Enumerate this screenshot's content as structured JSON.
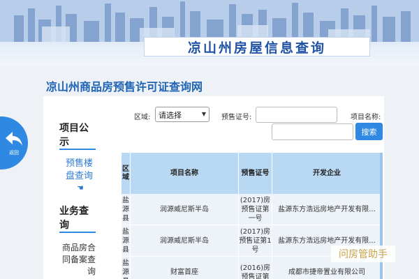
{
  "banner": {
    "title": "凉山州房屋信息查询"
  },
  "site": {
    "title": "凉山州商品房预售许可证查询网"
  },
  "back": {
    "label": "返回",
    "icon": "back-arrow-icon"
  },
  "nav": {
    "section1_title": "项目公示",
    "presale_item": "预售楼盘查询",
    "presale_icon": "☚",
    "section2_title": "业务查询",
    "contract_item": "商品房合同备案查询"
  },
  "search": {
    "region_label": "区域:",
    "region_value": "请选择",
    "license_label": "预售证号:",
    "license_value": "",
    "project_label": "项目名称:",
    "project_value": "",
    "button": "搜索"
  },
  "table": {
    "columns": [
      "区域",
      "项目名称",
      "预售证号",
      "开发企业"
    ],
    "rows": [
      {
        "region": "盐源县",
        "project": "润源威尼斯半岛",
        "license": "(2017)房预售证第一号",
        "developer": "盐源东方浩远房地产开发有限..."
      },
      {
        "region": "盐源县",
        "project": "润源威尼斯半岛",
        "license": "(2017)房预售证第1号",
        "developer": "盐源东方浩远房地产开发有限..."
      },
      {
        "region": "盐源县",
        "project": "财富首座",
        "license": "(2016)房预售证第",
        "developer": "成都市捷帝置业有限公司"
      }
    ]
  },
  "watermark": "问房管助手",
  "colors": {
    "accent": "#2f89e3",
    "title_blue": "#1f63b5",
    "table_header": "#b9d8f3"
  }
}
